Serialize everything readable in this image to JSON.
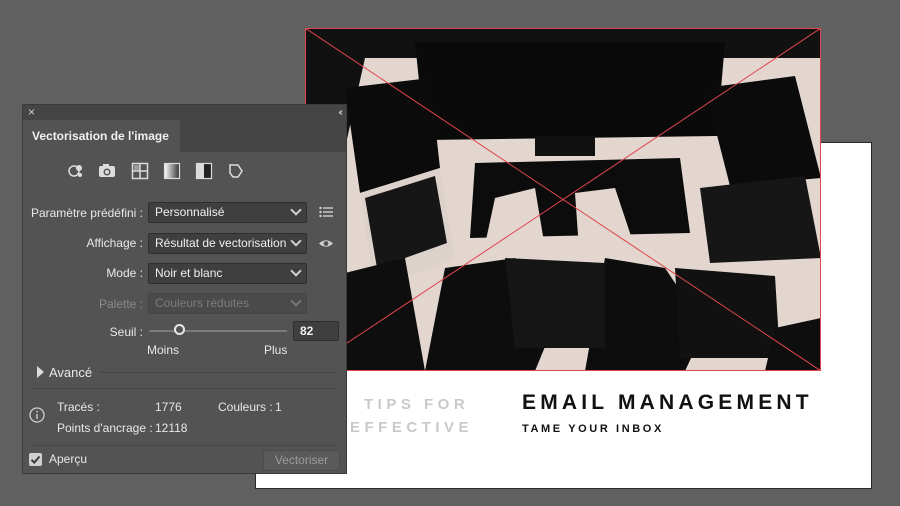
{
  "artboard": {
    "headline": "EMAIL MANAGEMENT",
    "subheadline": "TAME YOUR INBOX",
    "faded_line1": "TIPS FOR",
    "faded_line2": "EFFECTIVE"
  },
  "panel": {
    "close_label": "×",
    "collapse_label": "‹‹",
    "tab_title": "Vectorisation de l'image",
    "presets_icons": [
      "auto-color-icon",
      "high-color-icon",
      "low-color-icon",
      "grayscale-icon",
      "black-white-icon",
      "outline-icon"
    ],
    "preset": {
      "label": "Paramètre prédéfini :",
      "value": "Personnalisé"
    },
    "view": {
      "label": "Affichage :",
      "value": "Résultat de vectorisation"
    },
    "mode": {
      "label": "Mode :",
      "value": "Noir et blanc"
    },
    "palette": {
      "label": "Palette :",
      "value": "Couleurs réduites"
    },
    "threshold": {
      "label": "Seuil :",
      "value": "82",
      "fraction": 0.22,
      "min_label": "Moins",
      "max_label": "Plus"
    },
    "advanced_label": "Avancé",
    "stats": {
      "paths_label": "Tracés :",
      "paths_value": "1776",
      "colors_label": "Couleurs :",
      "colors_value": "1",
      "anchors_label": "Points d'ancrage :",
      "anchors_value": "12118"
    },
    "preview_label": "Aperçu",
    "preview_checked": true,
    "trace_button": "Vectoriser"
  },
  "colors": {
    "bbox": "#e0464e",
    "panel_bg": "#535353"
  }
}
